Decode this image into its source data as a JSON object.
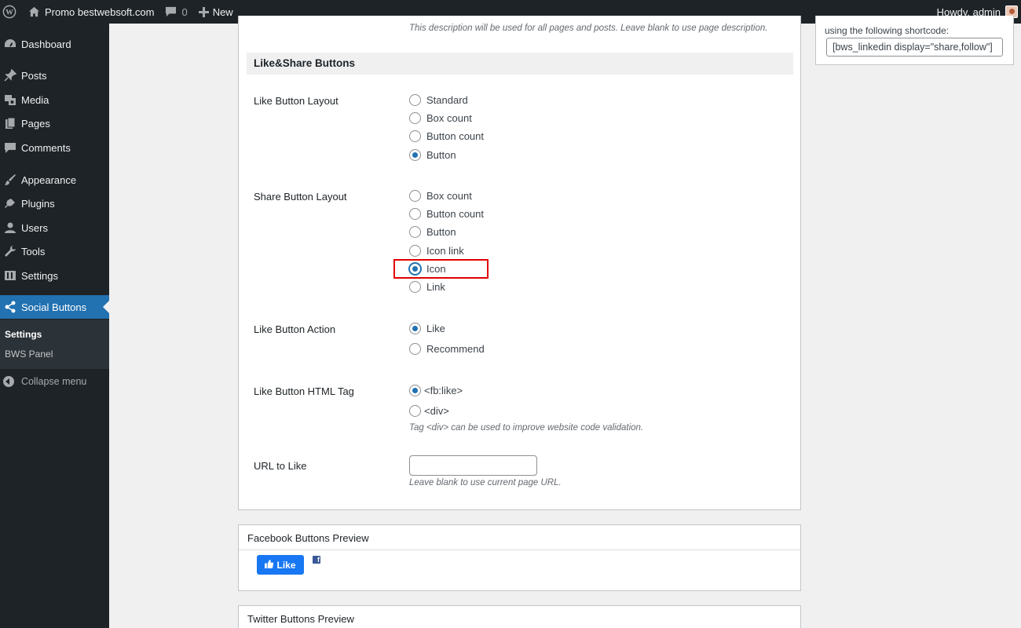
{
  "admin_bar": {
    "site_name": "Promo bestwebsoft.com",
    "comments_count": "0",
    "new_label": "New",
    "greeting": "Howdy, admin",
    "icons": [
      "wordpress-logo-icon",
      "home-icon",
      "comment-bubble-icon",
      "plus-icon",
      "avatar"
    ]
  },
  "sidebar": {
    "items": [
      {
        "label": "Dashboard",
        "icon": "dashboard-icon"
      },
      {
        "label": "Posts",
        "icon": "pin-icon"
      },
      {
        "label": "Media",
        "icon": "media-icon"
      },
      {
        "label": "Pages",
        "icon": "pages-icon"
      },
      {
        "label": "Comments",
        "icon": "comment-icon"
      },
      {
        "label": "Appearance",
        "icon": "brush-icon"
      },
      {
        "label": "Plugins",
        "icon": "plug-icon"
      },
      {
        "label": "Users",
        "icon": "user-icon"
      },
      {
        "label": "Tools",
        "icon": "wrench-icon"
      },
      {
        "label": "Settings",
        "icon": "settings-icon"
      },
      {
        "label": "Social Buttons",
        "icon": "share-icon",
        "active": true
      }
    ],
    "submenu": [
      {
        "label": "Settings",
        "current": true
      },
      {
        "label": "BWS Panel"
      }
    ],
    "collapse_label": "Collapse menu"
  },
  "main": {
    "top_description": "This description will be used for all pages and posts. Leave blank to use page description.",
    "section_title": "Like&Share Buttons",
    "like_layout": {
      "label": "Like Button Layout",
      "options": [
        "Standard",
        "Box count",
        "Button count",
        "Button"
      ],
      "selected": "Button"
    },
    "share_layout": {
      "label": "Share Button Layout",
      "options": [
        "Box count",
        "Button count",
        "Button",
        "Icon link",
        "Icon",
        "Link"
      ],
      "selected": "Icon"
    },
    "like_action": {
      "label": "Like Button Action",
      "options": [
        "Like",
        "Recommend"
      ],
      "selected": "Like"
    },
    "html_tag": {
      "label": "Like Button HTML Tag",
      "options": [
        "<fb:like>",
        "<div>"
      ],
      "selected": "<fb:like>",
      "description": "Tag <div> can be used to improve website code validation."
    },
    "url_to_like": {
      "label": "URL to Like",
      "value": "",
      "description": "Leave blank to use current page URL."
    }
  },
  "previews": {
    "facebook_title": "Facebook Buttons Preview",
    "facebook_like_label": "Like",
    "twitter_title": "Twitter Buttons Preview"
  },
  "side_box": {
    "text": "using the following shortcode:",
    "shortcode": "[bws_linkedin display=\"share,follow\"]"
  },
  "colors": {
    "admin_bar_bg": "#1d2327",
    "accent": "#2271b1",
    "highlight_border": "#e00000",
    "facebook_blue": "#1877f2"
  }
}
